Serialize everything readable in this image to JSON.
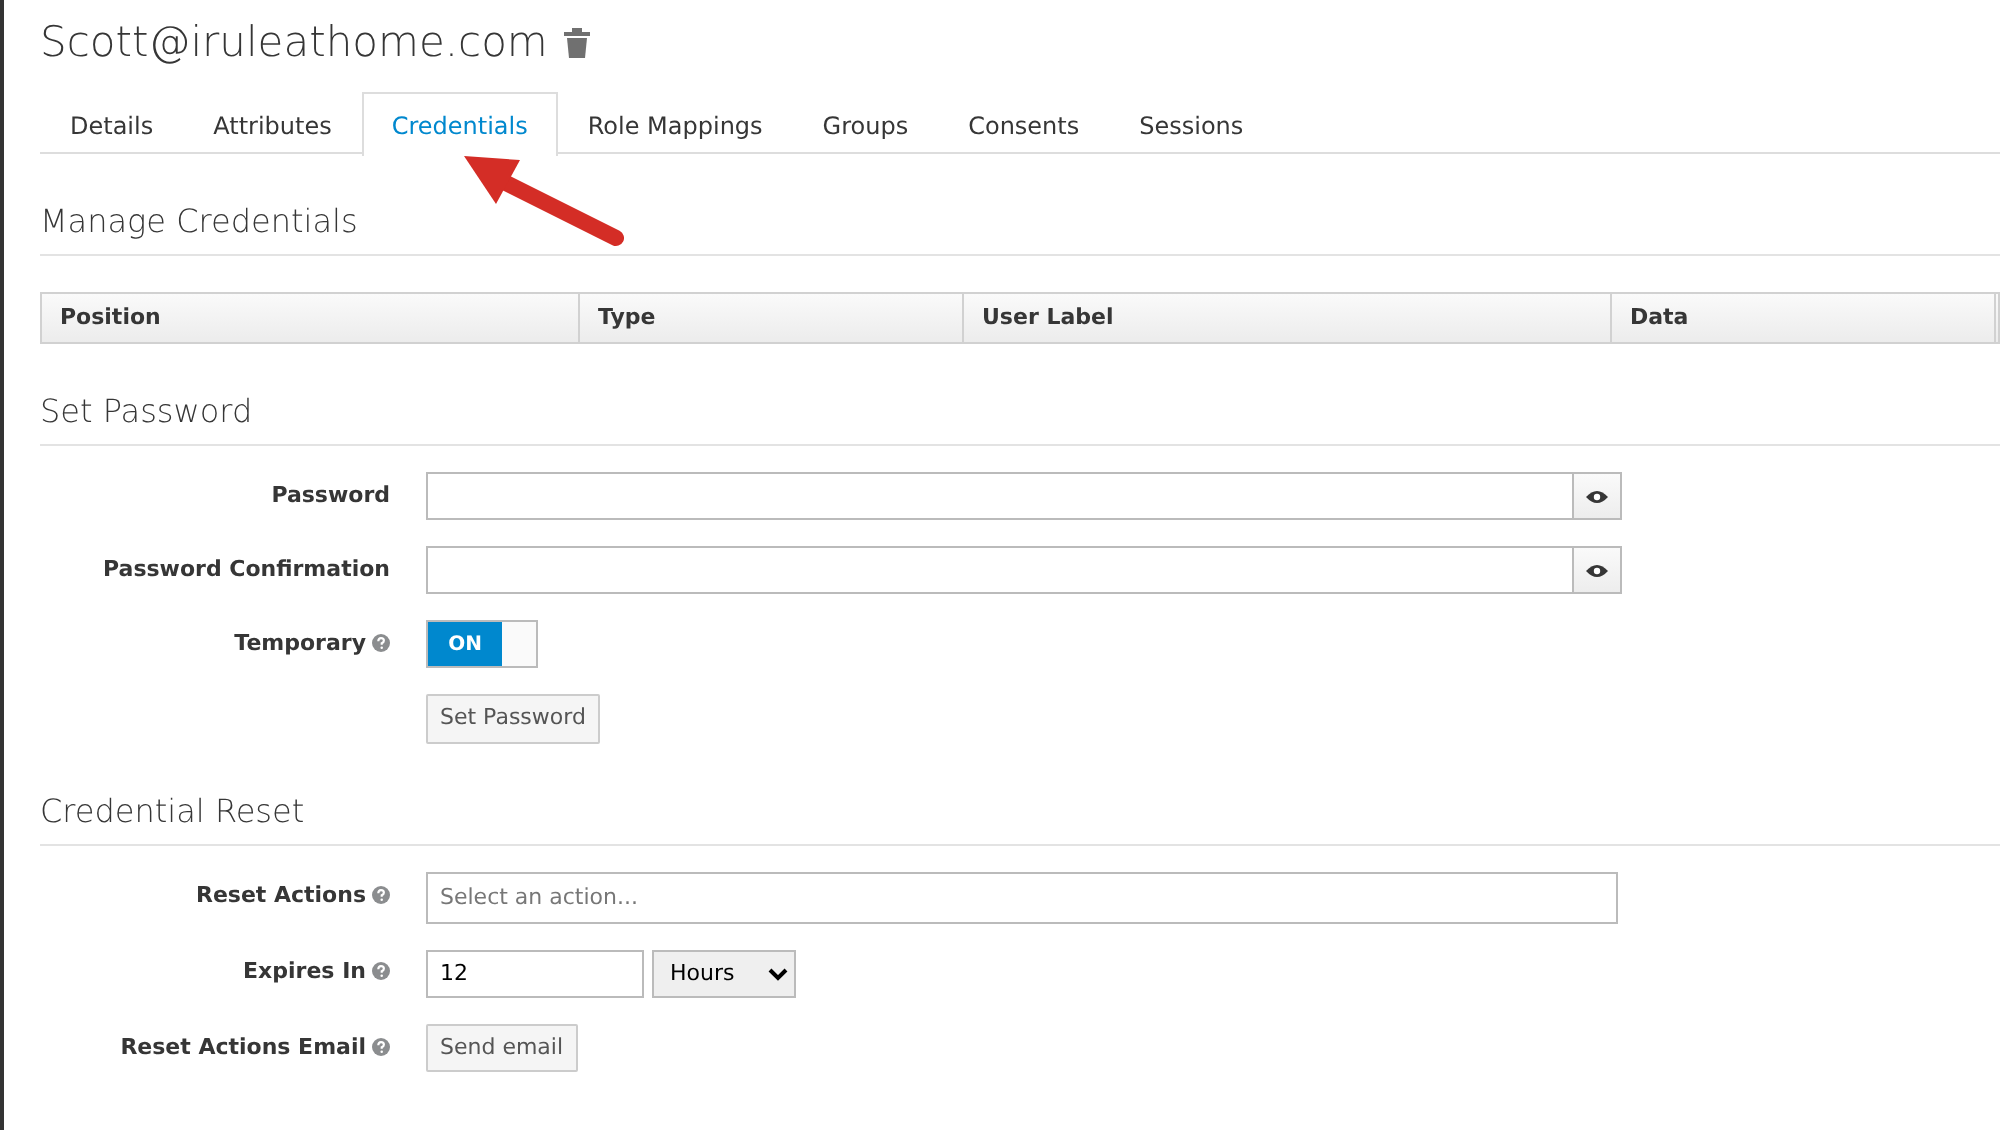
{
  "user": {
    "title": "Scott@iruleathome.com"
  },
  "tabs": [
    {
      "label": "Details",
      "selected": false
    },
    {
      "label": "Attributes",
      "selected": false
    },
    {
      "label": "Credentials",
      "selected": true
    },
    {
      "label": "Role Mappings",
      "selected": false
    },
    {
      "label": "Groups",
      "selected": false
    },
    {
      "label": "Consents",
      "selected": false
    },
    {
      "label": "Sessions",
      "selected": false
    }
  ],
  "manage_credentials": {
    "heading": "Manage Credentials",
    "columns": [
      "Position",
      "Type",
      "User Label",
      "Data"
    ]
  },
  "set_password": {
    "heading": "Set Password",
    "rows": [
      {
        "kind": "password",
        "label": "Password",
        "help": false
      },
      {
        "kind": "password",
        "label": "Password Confirmation",
        "help": false
      },
      {
        "kind": "toggle",
        "label": "Temporary",
        "help": true,
        "on": true,
        "text": "ON"
      },
      {
        "kind": "button",
        "text": "Set Password"
      }
    ]
  },
  "credential_reset": {
    "heading": "Credential Reset",
    "rows": [
      {
        "kind": "select",
        "label": "Reset Actions",
        "help": true,
        "placeholder": "Select an action..."
      },
      {
        "kind": "expiry",
        "label": "Expires In",
        "help": true,
        "value": "12",
        "unit": "Hours"
      },
      {
        "kind": "labeled_button",
        "label": "Reset Actions Email",
        "help": true,
        "text": "Send email"
      }
    ]
  }
}
